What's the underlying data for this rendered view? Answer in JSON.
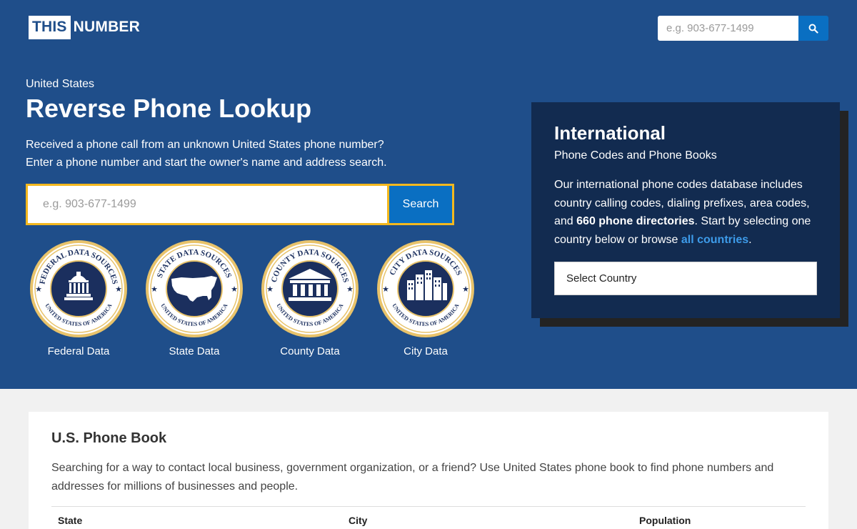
{
  "header": {
    "logo_box": "THIS",
    "logo_rest": "NUMBER",
    "search_placeholder": "e.g. 903-677-1499",
    "search_icon": "search-icon"
  },
  "hero": {
    "eyebrow": "United States",
    "title": "Reverse Phone Lookup",
    "desc_line1": "Received a phone call from an unknown United States phone number?",
    "desc_line2": "Enter a phone number and start the owner's name and address search.",
    "search_placeholder": "e.g. 903-677-1499",
    "search_button": "Search"
  },
  "seals": [
    {
      "ring_top": "FEDERAL DATA SOURCES",
      "ring_bottom": "UNITED STATES OF AMERICA",
      "icon": "capitol-icon",
      "label": "Federal Data"
    },
    {
      "ring_top": "STATE DATA SOURCES",
      "ring_bottom": "UNITED STATES OF AMERICA",
      "icon": "us-map-icon",
      "label": "State Data"
    },
    {
      "ring_top": "COUNTY DATA SOURCES",
      "ring_bottom": "UNITED STATES OF AMERICA",
      "icon": "courthouse-icon",
      "label": "County Data"
    },
    {
      "ring_top": "CITY DATA SOURCES",
      "ring_bottom": "UNITED STATES OF AMERICA",
      "icon": "city-icon",
      "label": "City Data"
    }
  ],
  "international": {
    "title": "International",
    "subtitle": "Phone Codes and Phone Books",
    "text_part1": "Our international phone codes database includes country calling codes, dialing prefixes, area codes, and ",
    "text_bold": "660 phone directories",
    "text_part2": ". Start by selecting one country below or browse ",
    "link": "all countries",
    "text_end": ".",
    "select_value": "Select Country"
  },
  "phonebook": {
    "title": "U.S. Phone Book",
    "desc": "Searching for a way to contact local business, government organization, or a friend? Use United States phone book to find phone numbers and addresses for millions of businesses and people.",
    "columns": [
      "State",
      "City",
      "Population"
    ]
  },
  "colors": {
    "hero_bg": "#1f4e8a",
    "panel_bg": "#122b50",
    "accent_blue": "#0a6fc2",
    "search_border": "#f3b81f",
    "seal_gold": "#e8c36b",
    "seal_navy": "#1b2f5e"
  }
}
